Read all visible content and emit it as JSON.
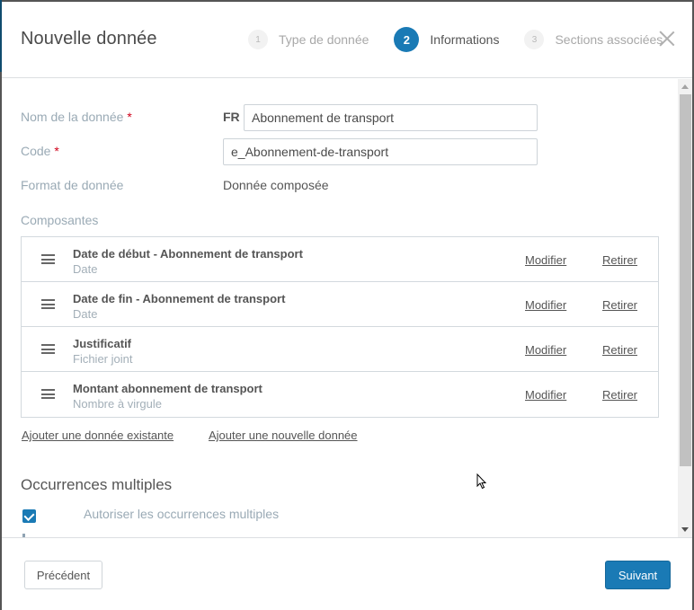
{
  "modal": {
    "title": "Nouvelle donnée",
    "close_icon": "close-icon"
  },
  "stepper": {
    "steps": [
      {
        "number": "1",
        "label": "Type de donnée",
        "state": "done"
      },
      {
        "number": "2",
        "label": "Informations",
        "state": "active"
      },
      {
        "number": "3",
        "label": "Sections associées",
        "state": "pending"
      }
    ]
  },
  "form": {
    "name_label": "Nom de la donnée",
    "required_mark": "*",
    "lang_tag": "FR",
    "name_value": "Abonnement de transport",
    "code_label": "Code",
    "code_value": "e_Abonnement-de-transport",
    "format_label": "Format de donnée",
    "format_value": "Donnée composée",
    "components_label": "Composantes"
  },
  "components": [
    {
      "name": "Date de début - Abonnement de transport",
      "type": "Date",
      "edit": "Modifier",
      "remove": "Retirer"
    },
    {
      "name": "Date de fin - Abonnement de transport",
      "type": "Date",
      "edit": "Modifier",
      "remove": "Retirer"
    },
    {
      "name": "Justificatif",
      "type": "Fichier joint",
      "edit": "Modifier",
      "remove": "Retirer"
    },
    {
      "name": "Montant abonnement de transport",
      "type": "Nombre à virgule",
      "edit": "Modifier",
      "remove": "Retirer"
    }
  ],
  "actions": {
    "add_existing": "Ajouter une donnée existante",
    "add_new": "Ajouter une nouvelle donnée"
  },
  "occurrences": {
    "title": "Occurrences multiples",
    "checkbox_label": "Autoriser les occurrences multiples",
    "checked": true
  },
  "footer": {
    "prev_label": "Précédent",
    "next_label": "Suivant"
  },
  "colors": {
    "accent": "#1a7ab5",
    "required": "#d0021b",
    "label_muted": "#9aaab5"
  }
}
